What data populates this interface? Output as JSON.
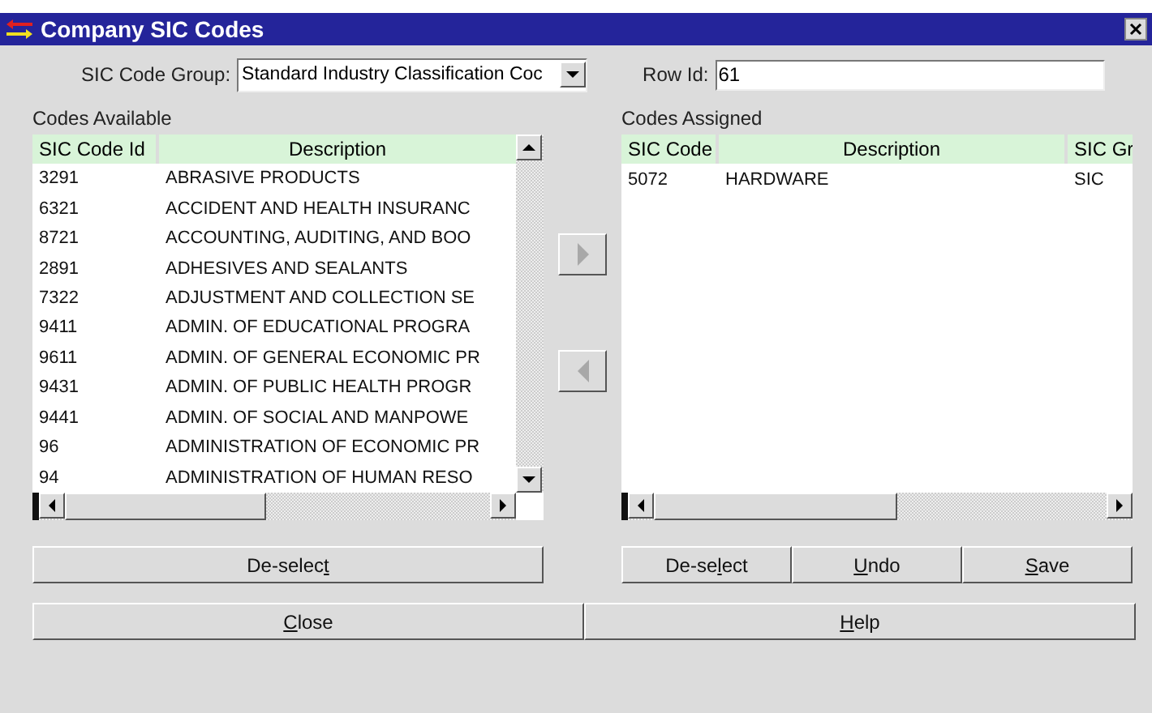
{
  "window": {
    "title": "Company SIC Codes"
  },
  "sic_code_group": {
    "label": "SIC Code Group:",
    "value": "Standard Industry Classification Coc"
  },
  "row_id": {
    "label": "Row Id:",
    "value": "61"
  },
  "codes_available": {
    "title": "Codes Available",
    "columns": [
      "SIC Code Id",
      "Description"
    ],
    "rows": [
      {
        "cells": [
          "3291",
          "ABRASIVE PRODUCTS"
        ]
      },
      {
        "cells": [
          "6321",
          "ACCIDENT AND HEALTH INSURANC"
        ]
      },
      {
        "cells": [
          "8721",
          "ACCOUNTING, AUDITING, AND BOO"
        ]
      },
      {
        "cells": [
          "2891",
          "ADHESIVES AND SEALANTS"
        ]
      },
      {
        "cells": [
          "7322",
          "ADJUSTMENT AND COLLECTION SE"
        ]
      },
      {
        "cells": [
          "9411",
          "ADMIN. OF EDUCATIONAL PROGRA"
        ]
      },
      {
        "cells": [
          "9611",
          "ADMIN. OF GENERAL ECONOMIC PR"
        ]
      },
      {
        "cells": [
          "9431",
          "ADMIN. OF PUBLIC HEALTH PROGR"
        ]
      },
      {
        "cells": [
          "9441",
          "ADMIN. OF SOCIAL AND MANPOWE"
        ]
      },
      {
        "cells": [
          "96",
          "ADMINISTRATION OF ECONOMIC PR"
        ]
      },
      {
        "cells": [
          "94",
          "ADMINISTRATION OF HUMAN RESO"
        ]
      }
    ],
    "buttons": [
      {
        "before": "De-selec",
        "mnemonic": "t"
      }
    ]
  },
  "transfer_buttons": [
    {
      "kind": "right",
      "disabled": true
    },
    {
      "kind": "left",
      "disabled": true
    }
  ],
  "codes_assigned": {
    "title": "Codes Assigned",
    "columns": [
      "SIC Code",
      "Description",
      "SIC Gr"
    ],
    "rows": [
      {
        "cells": [
          "5072",
          "HARDWARE",
          "SIC"
        ]
      }
    ],
    "buttons": [
      {
        "before": "De-se",
        "mnemonic": "l",
        "after": "ect"
      },
      {
        "mnemonic": "U",
        "after": "ndo"
      },
      {
        "mnemonic": "S",
        "after": "ave"
      }
    ]
  },
  "footer_buttons": [
    {
      "mnemonic": "C",
      "after": "lose"
    },
    {
      "mnemonic": "H",
      "after": "elp"
    }
  ]
}
